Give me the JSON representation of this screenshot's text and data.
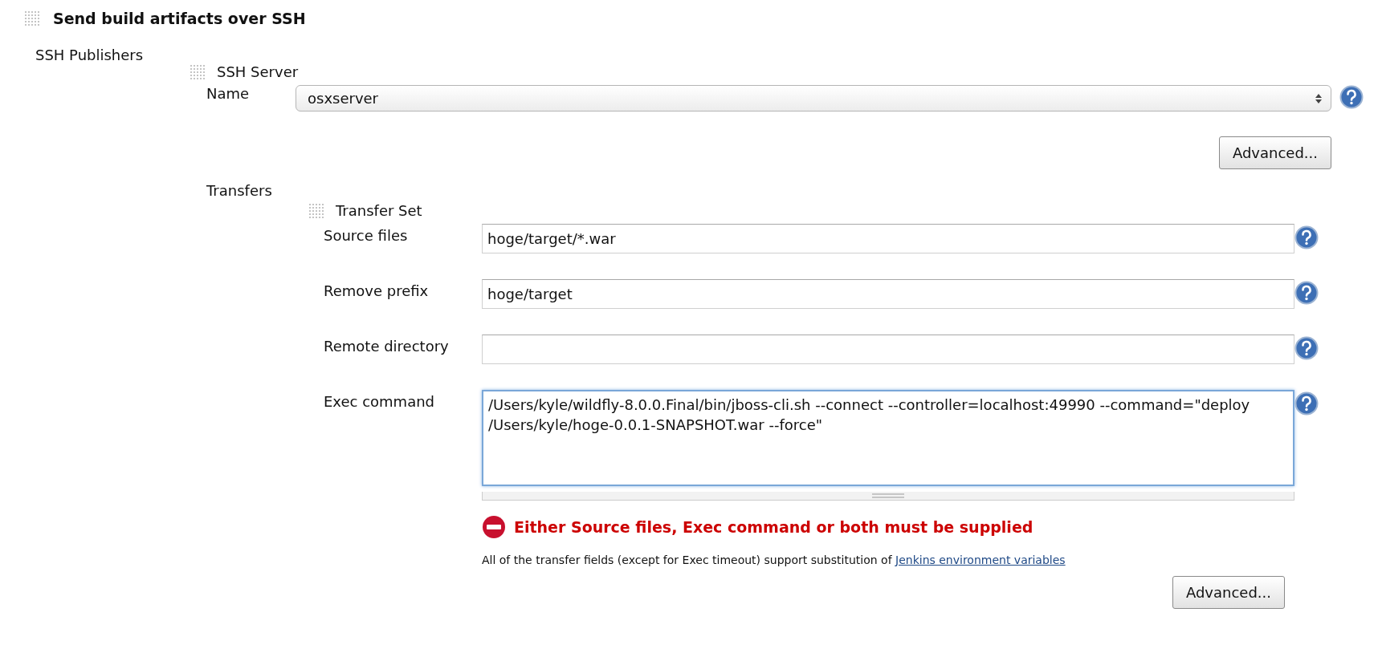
{
  "section": {
    "title": "Send build artifacts over SSH"
  },
  "publishers": {
    "label": "SSH Publishers",
    "server": {
      "title": "SSH Server",
      "name_label": "Name",
      "name_value": "osxserver",
      "advanced": "Advanced..."
    },
    "transfers": {
      "label": "Transfers",
      "set_title": "Transfer Set",
      "fields": [
        {
          "label": "Source files",
          "kind": "input",
          "value": "hoge/target/*.war",
          "focused": false
        },
        {
          "label": "Remove prefix",
          "kind": "input",
          "value": "hoge/target",
          "focused": false
        },
        {
          "label": "Remote directory",
          "kind": "input",
          "focused": false
        },
        {
          "label": "Exec command",
          "kind": "textarea",
          "value": "/Users/kyle/wildfly-8.0.0.Final/bin/jboss-cli.sh --connect --controller=localhost:49990 --command=\"deploy /Users/kyle/hoge-0.0.1-SNAPSHOT.war --force\"",
          "focused": true
        }
      ],
      "error": "Either Source files, Exec command or both must be supplied",
      "note": {
        "text": "All of the transfer fields (except for Exec timeout) support substitution of",
        "link": "Jenkins environment variables"
      },
      "advanced": "Advanced..."
    }
  }
}
